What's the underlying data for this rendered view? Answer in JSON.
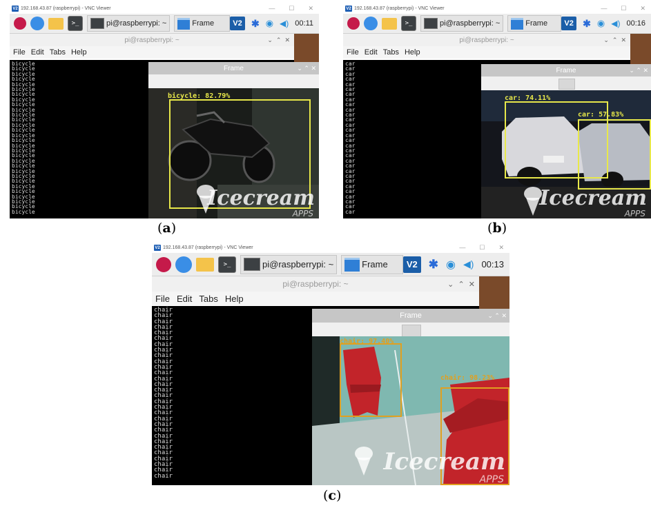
{
  "panels": [
    {
      "id": "a",
      "caption": "a",
      "window_title": "192.168.43.87 (raspberrypi) - VNC Viewer",
      "taskbar_terminal_label": "pi@raspberrypi: ~",
      "taskbar_frame_label": "Frame",
      "clock": "00:11",
      "terminal_title": "pi@raspberrypi: ~",
      "menu": [
        "File",
        "Edit",
        "Tabs",
        "Help"
      ],
      "console_word": "bicycle",
      "frame_title": "Frame",
      "detections": [
        {
          "label": "bicycle: 82.79%",
          "color": "#e8e84a"
        }
      ],
      "watermark": "Icecream",
      "watermark_sub": "APPS"
    },
    {
      "id": "b",
      "caption": "b",
      "window_title": "192.168.43.87 (raspberrypi) - VNC Viewer",
      "taskbar_terminal_label": "pi@raspberrypi: ~",
      "taskbar_frame_label": "Frame",
      "clock": "00:16",
      "terminal_title": "pi@raspberrypi: ~",
      "menu": [
        "File",
        "Edit",
        "Tabs",
        "Help"
      ],
      "console_word": "car",
      "frame_title": "Frame",
      "detections": [
        {
          "label": "car: 74.11%",
          "color": "#e8e84a"
        },
        {
          "label": "car: 57.83%",
          "color": "#e8e84a"
        }
      ],
      "watermark": "Icecream",
      "watermark_sub": "APPS"
    },
    {
      "id": "c",
      "caption": "c",
      "window_title": "192.168.43.87 (raspberrypi) - VNC Viewer",
      "taskbar_terminal_label": "pi@raspberrypi: ~",
      "taskbar_frame_label": "Frame",
      "clock": "00:13",
      "terminal_title": "pi@raspberrypi: ~",
      "menu": [
        "File",
        "Edit",
        "Tabs",
        "Help"
      ],
      "console_word": "chair",
      "frame_title": "Frame",
      "detections": [
        {
          "label": "chair: 97.40%",
          "color": "#e0a020"
        },
        {
          "label": "chair: 98.23%",
          "color": "#e0a020"
        }
      ],
      "watermark": "Icecream",
      "watermark_sub": "APPS"
    }
  ]
}
